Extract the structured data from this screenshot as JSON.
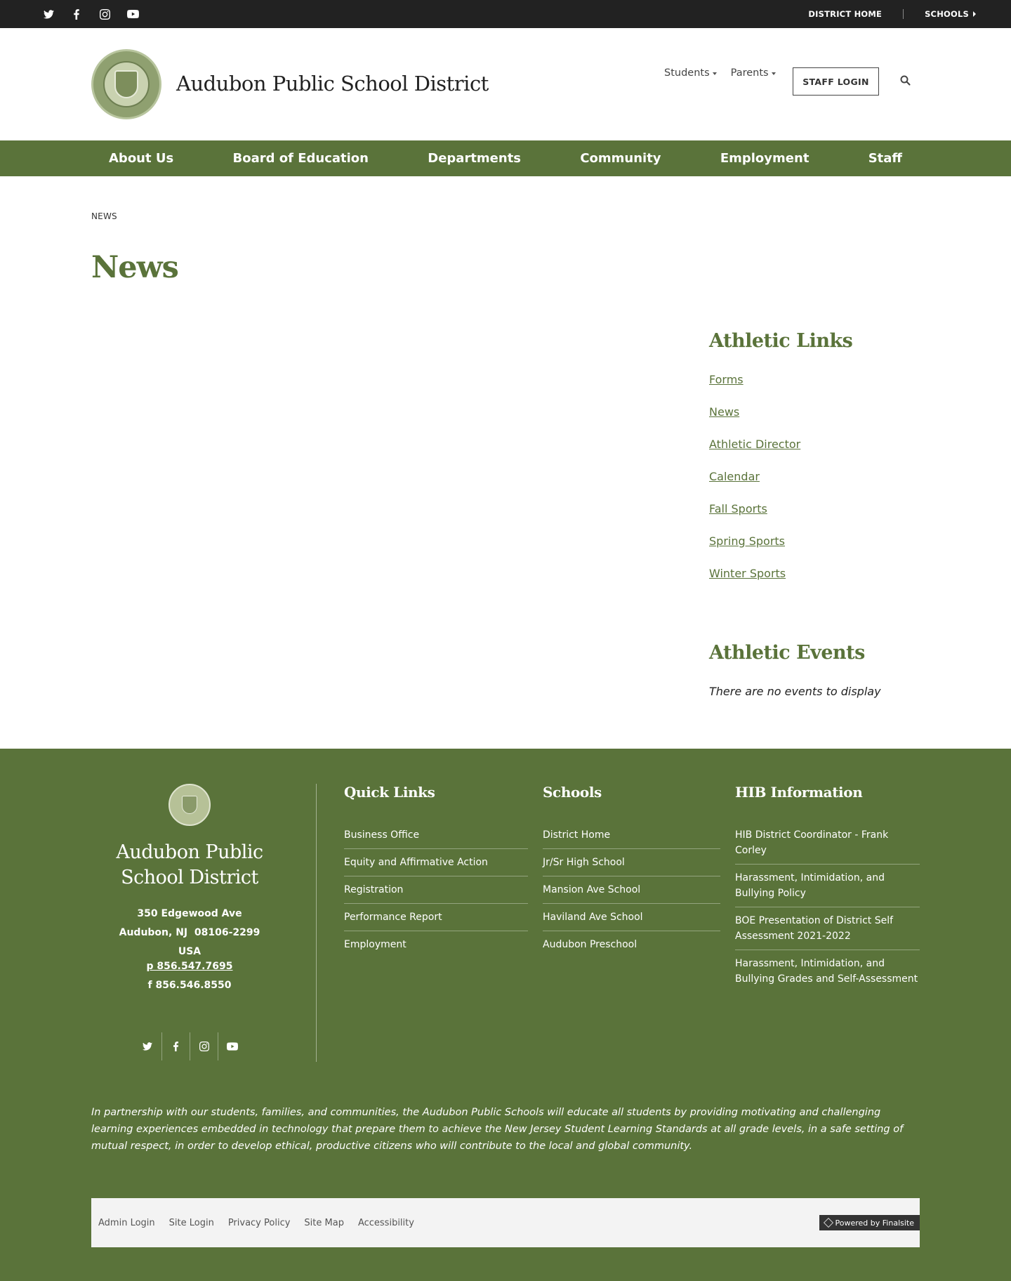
{
  "topbar": {
    "social": [
      "twitter-icon",
      "facebook-icon",
      "instagram-icon",
      "youtube-icon"
    ],
    "district_home": "DISTRICT HOME",
    "schools": "SCHOOLS"
  },
  "header": {
    "site_title": "Audubon Public School District",
    "nav": [
      {
        "label": "Students"
      },
      {
        "label": "Parents"
      }
    ],
    "staff_login": "STAFF LOGIN",
    "search_icon": "search-icon"
  },
  "main_nav": {
    "items": [
      {
        "label": "About Us"
      },
      {
        "label": "Board of Education"
      },
      {
        "label": "Departments"
      },
      {
        "label": "Community"
      },
      {
        "label": "Employment"
      },
      {
        "label": "Staff"
      }
    ]
  },
  "content": {
    "breadcrumb": "NEWS",
    "page_title": "News"
  },
  "sidebar": {
    "athletic_links": {
      "heading": "Athletic Links",
      "links": [
        {
          "label": "Forms"
        },
        {
          "label": "News"
        },
        {
          "label": "Athletic Director"
        },
        {
          "label": "Calendar"
        },
        {
          "label": "Fall Sports"
        },
        {
          "label": "Spring Sports"
        },
        {
          "label": "Winter Sports"
        }
      ]
    },
    "athletic_events": {
      "heading": "Athletic Events",
      "empty_text": "There are no events to display"
    }
  },
  "footer": {
    "name": "Audubon Public School District",
    "address_line1": "350 Edgewood Ave",
    "address_line2": "Audubon, NJ  08106-2299",
    "country": "USA",
    "phone": "p 856.547.7695",
    "fax": "f 856.546.8550",
    "social": [
      "twitter-icon",
      "facebook-icon",
      "instagram-icon",
      "youtube-icon"
    ],
    "quick_links": {
      "heading": "Quick Links",
      "items": [
        {
          "label": "Business Office"
        },
        {
          "label": "Equity and Affirmative Action"
        },
        {
          "label": "Registration"
        },
        {
          "label": "Performance Report"
        },
        {
          "label": "Employment"
        }
      ]
    },
    "schools": {
      "heading": "Schools",
      "items": [
        {
          "label": "District Home"
        },
        {
          "label": "Jr/Sr High School"
        },
        {
          "label": "Mansion Ave School"
        },
        {
          "label": "Haviland Ave School"
        },
        {
          "label": "Audubon Preschool"
        }
      ]
    },
    "hib": {
      "heading": "HIB Information",
      "items": [
        {
          "label": "HIB District Coordinator - Frank Corley"
        },
        {
          "label": "Harassment, Intimidation, and Bullying Policy"
        },
        {
          "label": "BOE Presentation of District Self Assessment 2021-2022"
        },
        {
          "label": "Harassment, Intimidation, and Bullying Grades and Self-Assessment"
        }
      ]
    },
    "mission": "In partnership with our students, families, and communities, the Audubon Public Schools will educate all students by providing motivating and challenging learning experiences embedded in technology that prepare them to achieve the New Jersey Student Learning Standards at all grade levels, in a safe setting of mutual respect, in order to develop ethical, productive citizens who will contribute to the local and global community.",
    "bottom_links": [
      {
        "label": "Admin Login"
      },
      {
        "label": "Site Login"
      },
      {
        "label": "Privacy Policy"
      },
      {
        "label": "Site Map"
      },
      {
        "label": "Accessibility"
      }
    ],
    "powered_by": "Powered by Finalsite"
  },
  "colors": {
    "brand_green": "#5a733a",
    "topbar": "#222222",
    "bottom_bar": "#f3f3f3"
  }
}
